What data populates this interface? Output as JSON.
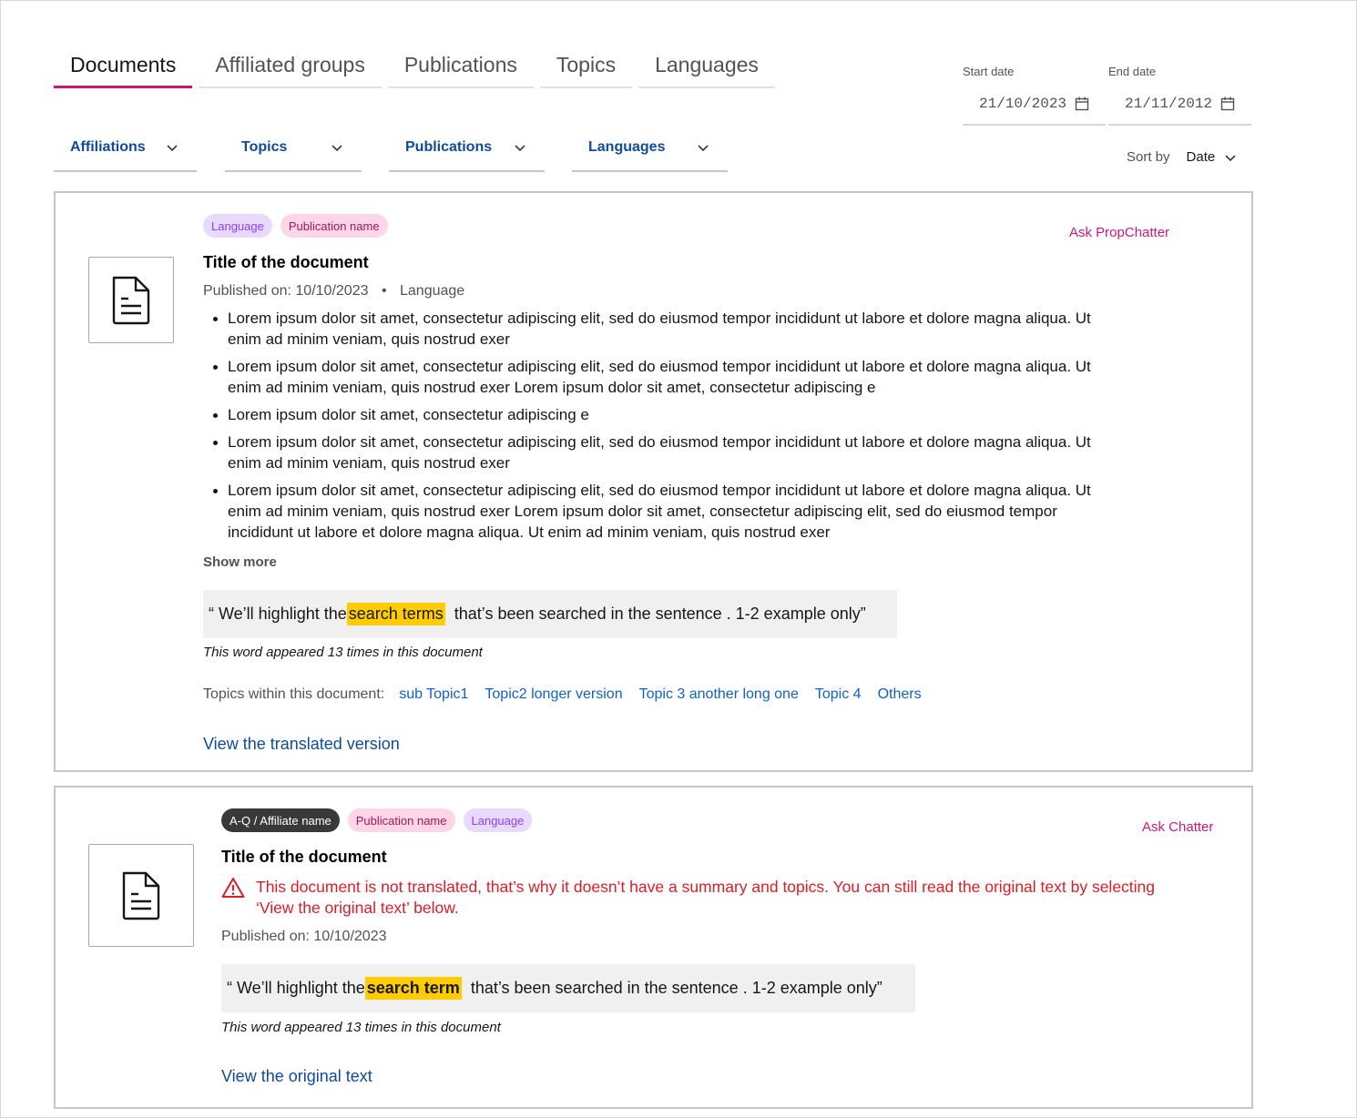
{
  "tabs": [
    {
      "label": "Documents",
      "active": true
    },
    {
      "label": "Affiliated groups",
      "active": false
    },
    {
      "label": "Publications",
      "active": false
    },
    {
      "label": "Topics",
      "active": false
    },
    {
      "label": "Languages",
      "active": false
    }
  ],
  "dates": {
    "start_label": "Start date",
    "start_value": "21/10/2023",
    "end_label": "End date",
    "end_value": "21/11/2012"
  },
  "filters": [
    "Affiliations",
    "Topics",
    "Publications",
    "Languages"
  ],
  "sort": {
    "label": "Sort by",
    "value": "Date"
  },
  "cards": [
    {
      "tags": [
        "Language",
        "Publication name"
      ],
      "ask_label": "Ask PropChatter",
      "title": "Title of the document",
      "published": "Published on: 10/10/2023",
      "language": "Language",
      "bullets": [
        "Lorem ipsum dolor sit amet, consectetur adipiscing elit, sed do eiusmod tempor incididunt ut labore et dolore magna aliqua. Ut enim ad minim veniam, quis nostrud exer",
        "Lorem ipsum dolor sit amet, consectetur adipiscing elit, sed do eiusmod tempor incididunt ut labore et dolore magna aliqua. Ut enim ad minim veniam, quis nostrud exer Lorem ipsum dolor sit amet, consectetur adipiscing e",
        "Lorem ipsum dolor sit amet, consectetur adipiscing e",
        "Lorem ipsum dolor sit amet, consectetur adipiscing elit, sed do eiusmod tempor incididunt ut labore et dolore magna aliqua. Ut enim ad minim veniam, quis nostrud exer",
        "Lorem ipsum dolor sit amet, consectetur adipiscing elit, sed do eiusmod tempor incididunt ut labore et dolore magna aliqua. Ut enim ad minim veniam, quis nostrud exer Lorem ipsum dolor sit amet, consectetur adipiscing elit, sed do eiusmod tempor incididunt ut labore et dolore magna aliqua. Ut enim ad minim veniam, quis nostrud exer"
      ],
      "show_more": "Show more",
      "quote_before": "“ We’ll highlight the ",
      "quote_highlight": "search terms",
      "quote_after": "  that’s been searched in the sentence . 1-2 example only”",
      "appeared": "This word appeared 13 times in this document",
      "topics_label": "Topics within this document:",
      "topics": [
        "sub Topic1",
        "Topic2 longer version",
        "Topic 3 another long one",
        "Topic 4",
        "Others"
      ],
      "link": "View the translated version"
    },
    {
      "tags": [
        "A-Q / Affiliate name",
        "Publication name",
        "Language"
      ],
      "ask_label": "Ask Chatter",
      "title": "Title of the document",
      "warning": "This document is not translated, that’s why it doesn’t have a summary and topics. You can still read the original text by selecting ‘View the original text’ below.",
      "published": "Published on: 10/10/2023",
      "quote_before": "“ We’ll highlight the ",
      "quote_highlight": "search term",
      "quote_after": "  that’s been searched in the sentence . 1-2 example only”",
      "appeared": "This word appeared 13 times in this document",
      "link": "View the original text"
    }
  ],
  "colors": {
    "accent": "#d0156f",
    "link": "#0f4b9a",
    "highlight": "#ffcc00",
    "warning": "#da1e28"
  }
}
